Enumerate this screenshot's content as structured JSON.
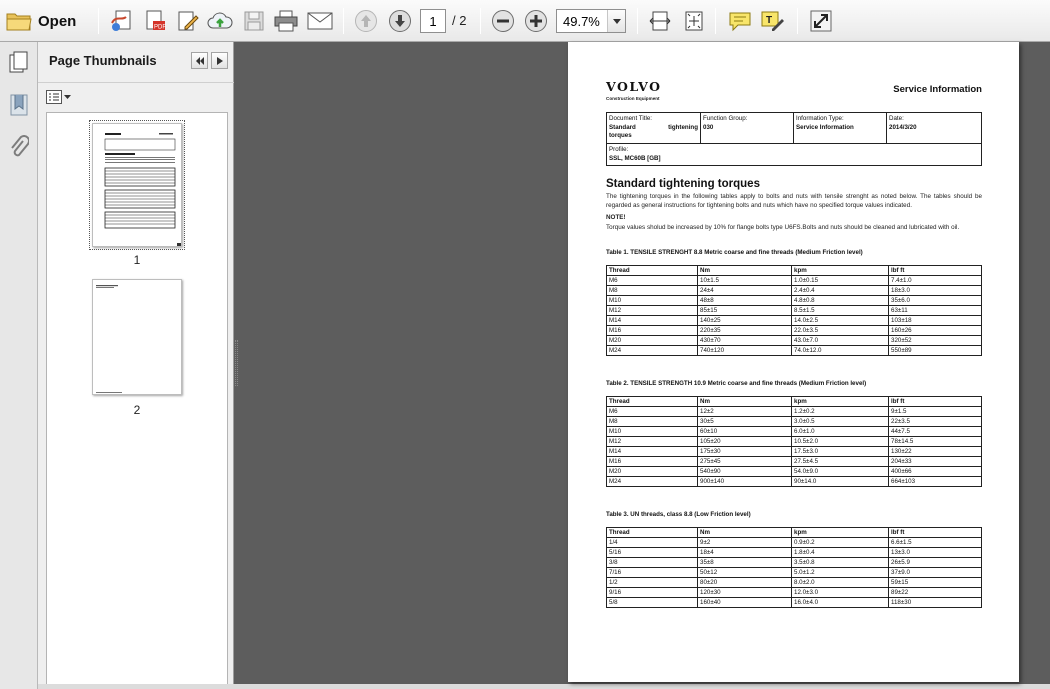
{
  "toolbar": {
    "open_label": "Open",
    "current_page": "1",
    "total_pages": "/ 2",
    "zoom": "49.7%"
  },
  "thumbnails": {
    "title": "Page Thumbnails",
    "pages": [
      "1",
      "2"
    ]
  },
  "document": {
    "brand": "VOLVO",
    "brand_sub": "Construction Equipment",
    "header_right": "Service Information",
    "info": {
      "doc_title_label": "Document Title:",
      "doc_title_value_a": "Standard",
      "doc_title_value_b": "tightening",
      "doc_title_value_c": "torques",
      "function_group_label": "Function Group:",
      "function_group_value": "030",
      "info_type_label": "Information Type:",
      "info_type_value": "Service Information",
      "date_label": "Date:",
      "date_value": "2014/3/20",
      "profile_label": "Profile:",
      "profile_value": "SSL, MC60B [GB]"
    },
    "title": "Standard tightening torques",
    "intro": "The tightening torques in the following tables apply to bolts and nuts with tensile strenght as noted below. The tables should be regarded as general instructions for tightening bolts and nuts which have no specified torque values indicated.",
    "note_label": "NOTE!",
    "note_text": "Torque values sholud be increased by 10% for flange bolts type U6FS.Bolts and nuts should be cleaned and lubricated with oil.",
    "tables": [
      {
        "caption": "Table 1. TENSILE STRENGHT 8.8 Metric coarse and fine threads (Medium Friction level)",
        "headers": [
          "Thread",
          "Nm",
          "kpm",
          "lbf ft"
        ],
        "rows": [
          [
            "M6",
            "10±1.5",
            "1.0±0.15",
            "7.4±1.0"
          ],
          [
            "M8",
            "24±4",
            "2.4±0.4",
            "18±3.0"
          ],
          [
            "M10",
            "48±8",
            "4.8±0.8",
            "35±6.0"
          ],
          [
            "M12",
            "85±15",
            "8.5±1.5",
            "63±11"
          ],
          [
            "M14",
            "140±25",
            "14.0±2.5",
            "103±18"
          ],
          [
            "M16",
            "220±35",
            "22.0±3.5",
            "160±26"
          ],
          [
            "M20",
            "430±70",
            "43.0±7.0",
            "320±52"
          ],
          [
            "M24",
            "740±120",
            "74.0±12.0",
            "550±89"
          ]
        ]
      },
      {
        "caption": "Table 2. TENSILE STRENGTH 10.9 Metric coarse and fine threads (Medium Friction level)",
        "headers": [
          "Thread",
          "Nm",
          "kpm",
          "lbf ft"
        ],
        "rows": [
          [
            "M6",
            "12±2",
            "1.2±0.2",
            "9±1.5"
          ],
          [
            "M8",
            "30±5",
            "3.0±0.5",
            "22±3.5"
          ],
          [
            "M10",
            "60±10",
            "6.0±1.0",
            "44±7.5"
          ],
          [
            "M12",
            "105±20",
            "10.5±2.0",
            "78±14.5"
          ],
          [
            "M14",
            "175±30",
            "17.5±3.0",
            "130±22"
          ],
          [
            "M16",
            "275±45",
            "27.5±4.5",
            "204±33"
          ],
          [
            "M20",
            "540±90",
            "54.0±9.0",
            "400±66"
          ],
          [
            "M24",
            "900±140",
            "90±14.0",
            "664±103"
          ]
        ]
      },
      {
        "caption": "Table 3. UN threads, class 8.8 (Low Friction level)",
        "headers": [
          "Thread",
          "Nm",
          "kpm",
          "lbf ft"
        ],
        "rows": [
          [
            "1/4",
            "9±2",
            "0.9±0.2",
            "6.6±1.5"
          ],
          [
            "5/16",
            "18±4",
            "1.8±0.4",
            "13±3.0"
          ],
          [
            "3/8",
            "35±8",
            "3.5±0.8",
            "26±5.9"
          ],
          [
            "7/16",
            "50±12",
            "5.0±1.2",
            "37±9.0"
          ],
          [
            "1/2",
            "80±20",
            "8.0±2.0",
            "59±15"
          ],
          [
            "9/16",
            "120±30",
            "12.0±3.0",
            "89±22"
          ],
          [
            "5/8",
            "160±40",
            "16.0±4.0",
            "118±30"
          ]
        ]
      }
    ]
  }
}
